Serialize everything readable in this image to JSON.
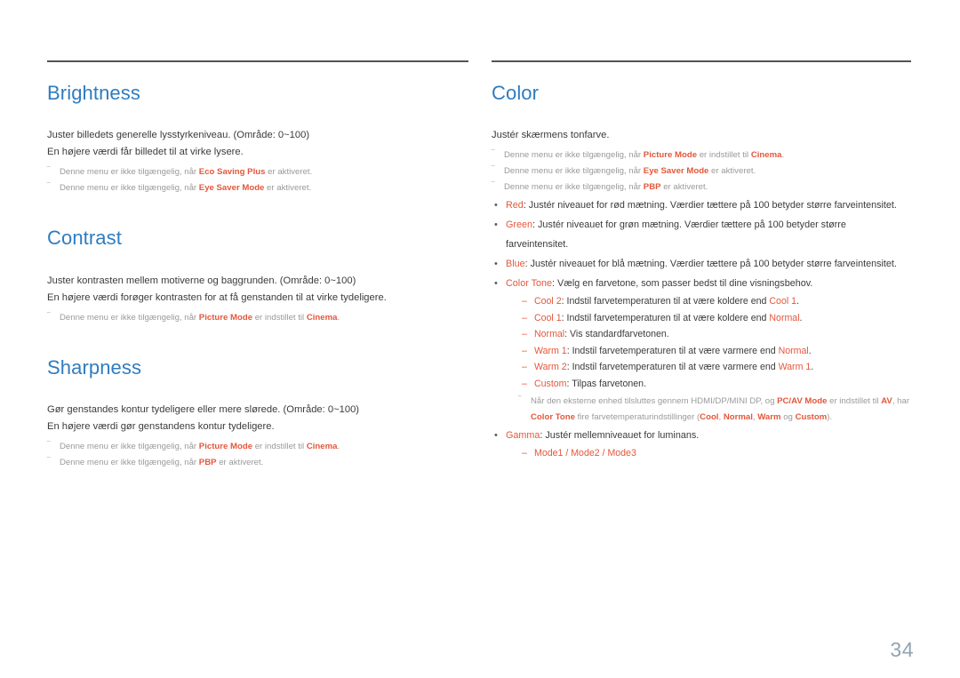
{
  "page": {
    "number": "34",
    "note_marker": "‾",
    "bullet_glyph": "•",
    "dash_glyph": "–",
    "colors": {
      "heading_blue": "#2f7cc0",
      "accent_orange": "#e4573b",
      "body_gray": "#3b3b3b",
      "note_gray": "#9a9a9a",
      "rule_gray": "#545454",
      "page_number_gray": "#93a3b0"
    }
  },
  "left_column": {
    "sections": [
      {
        "title": "Brightness",
        "body": [
          "Juster billedets generelle lysstyrkeniveau. (Område: 0~100)",
          "En højere værdi får billedet til at virke lysere."
        ],
        "notes": [
          {
            "parts": [
              {
                "text": "Denne menu er ikke tilgængelig, når ",
                "style": "plain"
              },
              {
                "text": "Eco Saving Plus",
                "style": "accent"
              },
              {
                "text": " er aktiveret.",
                "style": "plain"
              }
            ]
          },
          {
            "parts": [
              {
                "text": "Denne menu er ikke tilgængelig, når ",
                "style": "plain"
              },
              {
                "text": "Eye Saver Mode",
                "style": "accent"
              },
              {
                "text": " er aktiveret.",
                "style": "plain"
              }
            ]
          }
        ]
      },
      {
        "title": "Contrast",
        "body": [
          "Juster kontrasten mellem motiverne og baggrunden. (Område: 0~100)",
          "En højere værdi forøger kontrasten for at få genstanden til at virke tydeligere."
        ],
        "notes": [
          {
            "parts": [
              {
                "text": "Denne menu er ikke tilgængelig, når ",
                "style": "plain"
              },
              {
                "text": "Picture Mode",
                "style": "accent"
              },
              {
                "text": " er indstillet til ",
                "style": "plain"
              },
              {
                "text": "Cinema",
                "style": "accent"
              },
              {
                "text": ".",
                "style": "plain"
              }
            ]
          }
        ]
      },
      {
        "title": "Sharpness",
        "body": [
          "Gør genstandes kontur tydeligere eller mere slørede. (Område: 0~100)",
          "En højere værdi gør genstandens kontur tydeligere."
        ],
        "notes": [
          {
            "parts": [
              {
                "text": "Denne menu er ikke tilgængelig, når ",
                "style": "plain"
              },
              {
                "text": "Picture Mode",
                "style": "accent"
              },
              {
                "text": " er indstillet til ",
                "style": "plain"
              },
              {
                "text": "Cinema",
                "style": "accent"
              },
              {
                "text": ".",
                "style": "plain"
              }
            ]
          },
          {
            "parts": [
              {
                "text": "Denne menu er ikke tilgængelig, når ",
                "style": "plain"
              },
              {
                "text": "PBP",
                "style": "accent"
              },
              {
                "text": " er aktiveret.",
                "style": "plain"
              }
            ]
          }
        ]
      }
    ]
  },
  "right_column": {
    "section": {
      "title": "Color",
      "body": [
        "Justér skærmens tonfarve."
      ],
      "notes": [
        {
          "parts": [
            {
              "text": "Denne menu er ikke tilgængelig, når ",
              "style": "plain"
            },
            {
              "text": "Picture Mode",
              "style": "accent"
            },
            {
              "text": " er indstillet til ",
              "style": "plain"
            },
            {
              "text": "Cinema",
              "style": "accent"
            },
            {
              "text": ".",
              "style": "plain"
            }
          ]
        },
        {
          "parts": [
            {
              "text": "Denne menu er ikke tilgængelig, når ",
              "style": "plain"
            },
            {
              "text": "Eye Saver Mode",
              "style": "accent"
            },
            {
              "text": " er aktiveret.",
              "style": "plain"
            }
          ]
        },
        {
          "parts": [
            {
              "text": "Denne menu er ikke tilgængelig, når ",
              "style": "plain"
            },
            {
              "text": "PBP",
              "style": "accent"
            },
            {
              "text": " er aktiveret.",
              "style": "plain"
            }
          ]
        }
      ],
      "bullets": [
        {
          "name": "red",
          "parts": [
            {
              "text": "Red",
              "style": "accent"
            },
            {
              "text": ": Justér niveauet for rød mætning. Værdier tættere på 100 betyder større farveintensitet.",
              "style": "plain"
            }
          ]
        },
        {
          "name": "green",
          "parts": [
            {
              "text": "Green",
              "style": "accent"
            },
            {
              "text": ": Justér niveauet for grøn mætning. Værdier tættere på 100 betyder større farveintensitet.",
              "style": "plain"
            }
          ]
        },
        {
          "name": "blue",
          "parts": [
            {
              "text": "Blue",
              "style": "accent"
            },
            {
              "text": ": Justér niveauet for blå mætning. Værdier tættere på 100 betyder større farveintensitet.",
              "style": "plain"
            }
          ]
        },
        {
          "name": "color-tone",
          "parts": [
            {
              "text": "Color Tone",
              "style": "accent"
            },
            {
              "text": ": Vælg en farvetone, som passer bedst til dine visningsbehov.",
              "style": "plain"
            }
          ],
          "subitems": [
            {
              "parts": [
                {
                  "text": "Cool 2",
                  "style": "accent"
                },
                {
                  "text": ": Indstil farvetemperaturen til at være koldere end ",
                  "style": "plain"
                },
                {
                  "text": "Cool 1",
                  "style": "accent"
                },
                {
                  "text": ".",
                  "style": "plain"
                }
              ]
            },
            {
              "parts": [
                {
                  "text": "Cool 1",
                  "style": "accent"
                },
                {
                  "text": ": Indstil farvetemperaturen til at være koldere end ",
                  "style": "plain"
                },
                {
                  "text": "Normal",
                  "style": "accent"
                },
                {
                  "text": ".",
                  "style": "plain"
                }
              ]
            },
            {
              "parts": [
                {
                  "text": "Normal",
                  "style": "accent"
                },
                {
                  "text": ": Vis standardfarvetonen.",
                  "style": "plain"
                }
              ]
            },
            {
              "parts": [
                {
                  "text": "Warm 1",
                  "style": "accent"
                },
                {
                  "text": ": Indstil farvetemperaturen til at være varmere end ",
                  "style": "plain"
                },
                {
                  "text": "Normal",
                  "style": "accent"
                },
                {
                  "text": ".",
                  "style": "plain"
                }
              ]
            },
            {
              "parts": [
                {
                  "text": "Warm 2",
                  "style": "accent"
                },
                {
                  "text": ": Indstil farvetemperaturen til at være varmere end ",
                  "style": "plain"
                },
                {
                  "text": "Warm 1",
                  "style": "accent"
                },
                {
                  "text": ".",
                  "style": "plain"
                }
              ]
            },
            {
              "parts": [
                {
                  "text": "Custom",
                  "style": "accent"
                },
                {
                  "text": ": Tilpas farvetonen.",
                  "style": "plain"
                }
              ]
            }
          ],
          "trailing_note": {
            "parts": [
              {
                "text": "Når den eksterne enhed tilsluttes gennem HDMI/DP/MINI DP, og ",
                "style": "plain"
              },
              {
                "text": "PC/AV Mode",
                "style": "accent"
              },
              {
                "text": " er indstillet til ",
                "style": "plain"
              },
              {
                "text": "AV",
                "style": "accent"
              },
              {
                "text": ", har ",
                "style": "plain"
              },
              {
                "text": "Color Tone",
                "style": "accent"
              },
              {
                "text": " fire farvetemperaturindstillinger (",
                "style": "plain"
              },
              {
                "text": "Cool",
                "style": "accent"
              },
              {
                "text": ", ",
                "style": "plain"
              },
              {
                "text": "Normal",
                "style": "accent"
              },
              {
                "text": ", ",
                "style": "plain"
              },
              {
                "text": "Warm",
                "style": "accent"
              },
              {
                "text": " og ",
                "style": "plain"
              },
              {
                "text": "Custom",
                "style": "accent"
              },
              {
                "text": ").",
                "style": "plain"
              }
            ]
          }
        },
        {
          "name": "gamma",
          "parts": [
            {
              "text": "Gamma",
              "style": "accent"
            },
            {
              "text": ": Justér mellemniveauet for luminans.",
              "style": "plain"
            }
          ],
          "subitems": [
            {
              "parts": [
                {
                  "text": "Mode1 / Mode2 / Mode3",
                  "style": "accent"
                }
              ]
            }
          ]
        }
      ]
    }
  }
}
